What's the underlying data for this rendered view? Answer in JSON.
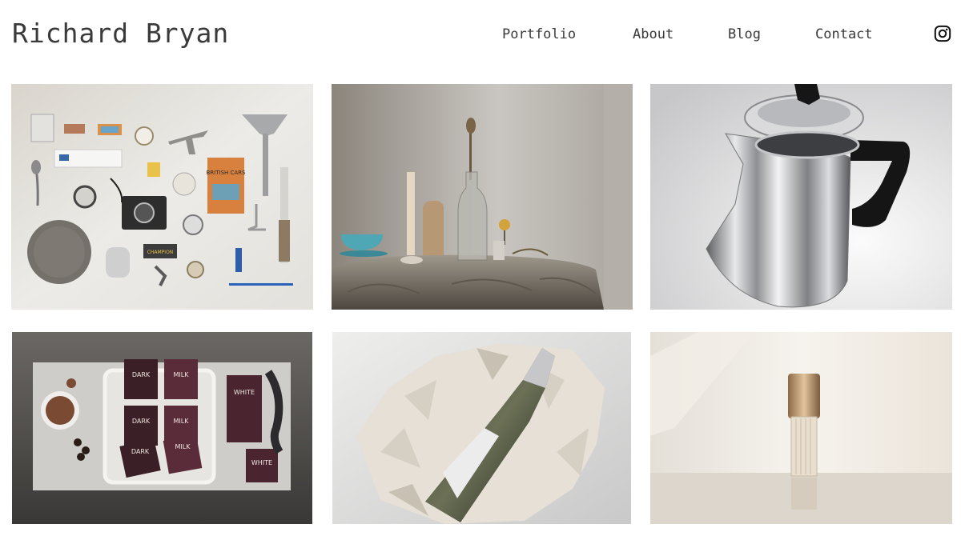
{
  "site": {
    "title": "Richard Bryan"
  },
  "nav": {
    "items": [
      "Portfolio",
      "About",
      "Blog",
      "Contact"
    ]
  },
  "social": {
    "icon": "instagram-icon"
  },
  "gallery": {
    "tile_3_text": {
      "box_label": "BRITISH CARS",
      "tin_label": "CHAMPION"
    },
    "tile_4_text": [
      "DARK",
      "MILK",
      "WHITE",
      "DARK",
      "MILK",
      "DARK",
      "MILK",
      "WHITE"
    ]
  }
}
